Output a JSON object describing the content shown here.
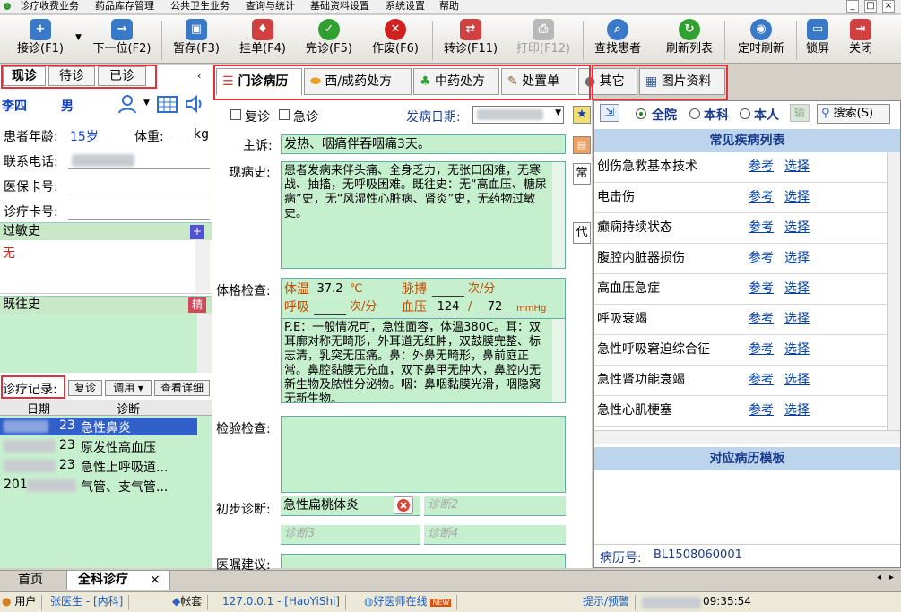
{
  "menu": [
    "诊疗收费业务",
    "药品库存管理",
    "公共卫生业务",
    "查询与统计",
    "基础资料设置",
    "系统设置",
    "帮助"
  ],
  "toolbar": {
    "items": [
      {
        "label": "接诊(F1)",
        "icon": "receive-patient-icon",
        "color": "#3a78c8"
      },
      {
        "label": "下一位(F2)",
        "icon": "next-patient-icon",
        "color": "#3a78c8"
      },
      {
        "label": "暂存(F3)",
        "icon": "save-draft-icon",
        "color": "#3a78c8"
      },
      {
        "label": "挂单(F4)",
        "icon": "hang-order-icon",
        "color": "#d04040"
      },
      {
        "label": "完诊(F5)",
        "icon": "complete-check-icon",
        "color": "#30a030"
      },
      {
        "label": "作废(F6)",
        "icon": "cancel-x-icon",
        "color": "#d02020"
      },
      {
        "label": "转诊(F11)",
        "icon": "transfer-icon",
        "color": "#d04040"
      },
      {
        "label": "打印(F12)",
        "icon": "print-icon",
        "color": "#b0b0b0",
        "disabled": true
      },
      {
        "label": "查找患者",
        "icon": "search-patient-icon",
        "color": "#3a78c8"
      },
      {
        "label": "刷新列表",
        "icon": "refresh-icon",
        "color": "#30a030"
      },
      {
        "label": "定时刷新",
        "icon": "timer-eye-icon",
        "color": "#3a78c8"
      },
      {
        "label": "锁屏",
        "icon": "lock-screen-icon",
        "color": "#3a78c8"
      },
      {
        "label": "关闭",
        "icon": "exit-icon",
        "color": "#d04040"
      }
    ]
  },
  "left": {
    "tabs": [
      "现诊",
      "待诊",
      "已诊"
    ],
    "patient_name": "李四",
    "patient_gender": "男",
    "age_label": "患者年龄:",
    "age_value": "15岁",
    "weight_label": "体重:",
    "weight_unit": "kg",
    "phone_label": "联系电话:",
    "insurance_label": "医保卡号:",
    "card_label": "诊疗卡号:",
    "allergy_title": "过敏史",
    "allergy_value": "无",
    "history_title": "既往史",
    "history_btn": "精",
    "records_label": "诊疗记录:",
    "revisit_btn": "复诊",
    "invoke_btn": "调用",
    "detail_btn": "查看详细",
    "col_date": "日期",
    "col_diag": "诊断",
    "records": [
      {
        "date": "23",
        "diag": "急性鼻炎"
      },
      {
        "date": "23",
        "diag": "原发性高血压"
      },
      {
        "date": "23",
        "diag": "急性上呼吸道..."
      },
      {
        "date": "201",
        "diag": "气管、支气管..."
      }
    ]
  },
  "main": {
    "tabs": [
      "门诊病历",
      "西/成药处方",
      "中药处方",
      "处置单",
      "其它",
      "图片资料"
    ],
    "revisit_cb": "复诊",
    "emergency_cb": "急诊",
    "onset_label": "发病日期:",
    "complaint_label": "主诉:",
    "complaint": "发热、咽痛伴吞咽痛3天。",
    "present_label": "现病史:",
    "present": "患者发病来伴头痛、全身乏力，无张口困难，无寒战、抽搐，无呼吸困难。既往史：无“高血压、糖尿病”史，无“风湿性心脏病、肾炎”史，无药物过敏史。",
    "exam_label": "体格检查:",
    "temp_label": "体温",
    "temp_value": "37.2",
    "temp_unit": "℃",
    "pulse_label": "脉搏",
    "pulse_unit": "次/分",
    "resp_label": "呼吸",
    "resp_unit": "次/分",
    "bp_label": "血压",
    "bp_sys": "124",
    "bp_sep": "/",
    "bp_dia": "72",
    "bp_unit": "mmHg",
    "pe_text": "P.E：一般情况可，急性面容，体温380C。耳：双耳廓对称无畸形，外耳道无红肿，双鼓膜完整、标志清，乳突无压痛。鼻：外鼻无畸形，鼻前庭正常。鼻腔黏膜无充血，双下鼻甲无肿大，鼻腔内无新生物及脓性分泌物。咽：鼻咽黏膜光滑，咽隐窝无新生物。",
    "lab_label": "检验检查:",
    "diag_label": "初步诊断:",
    "diag1": "急性扁桃体炎",
    "diag2": "诊断2",
    "diag3": "诊断3",
    "diag4": "诊断4",
    "advice_label": "医嘱建议:",
    "side_btns": [
      "常",
      "代"
    ]
  },
  "right": {
    "scope_all": "全院",
    "scope_dept": "本科",
    "scope_self": "本人",
    "input_btn": "输",
    "search_btn": "搜索(S)",
    "list_title": "常见疾病列表",
    "ref": "参考",
    "select": "选择",
    "diseases": [
      "创伤急救基本技术",
      "电击伤",
      "癫痫持续状态",
      "腹腔内脏器损伤",
      "高血压急症",
      "呼吸衰竭",
      "急性呼吸窘迫综合征",
      "急性肾功能衰竭",
      "急性心肌梗塞"
    ],
    "template_title": "对应病历模板",
    "record_no_label": "病历号:",
    "record_no": "BL1508060001"
  },
  "bottom_tabs": [
    "首页",
    "全科诊疗"
  ],
  "status": {
    "user_label": "用户",
    "user": "张医生 - [内科]",
    "account": "帐套",
    "server": "127.0.0.1 - [HaoYiShi]",
    "online": "好医师在线",
    "new_badge": "NEW",
    "alert": "提示/预警",
    "time": "09:35:54"
  }
}
